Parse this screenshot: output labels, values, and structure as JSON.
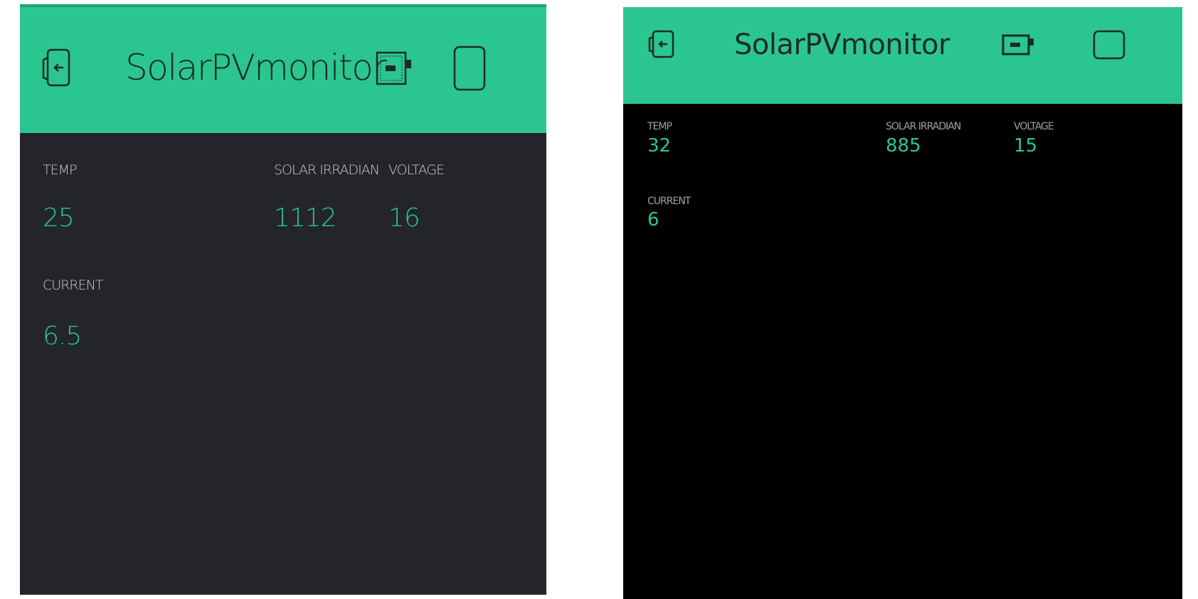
{
  "screens": [
    {
      "title": "SolarPVmonitor",
      "icons": [
        "exit-icon",
        "device-icon",
        "blank-square-icon"
      ],
      "widgets": {
        "temp": {
          "label": "TEMP",
          "value": "25"
        },
        "solar": {
          "label": "SOLAR IRRADIAN",
          "value": "1112"
        },
        "voltage": {
          "label": "VOLTAGE",
          "value": "16"
        },
        "current": {
          "label": "CURRENT",
          "value": "6.5"
        }
      }
    },
    {
      "title": "SolarPVmonitor",
      "icons": [
        "exit-icon",
        "device-icon",
        "blank-square-icon"
      ],
      "widgets": {
        "temp": {
          "label": "TEMP",
          "value": "32"
        },
        "solar": {
          "label": "SOLAR IRRADIAN",
          "value": "885"
        },
        "voltage": {
          "label": "VOLTAGE",
          "value": "15"
        },
        "current": {
          "label": "CURRENT",
          "value": "6"
        }
      }
    }
  ],
  "colors": {
    "header": "#2bc590",
    "value": "#2bc590",
    "background_a": "#23252b",
    "background_b": "#000000"
  }
}
